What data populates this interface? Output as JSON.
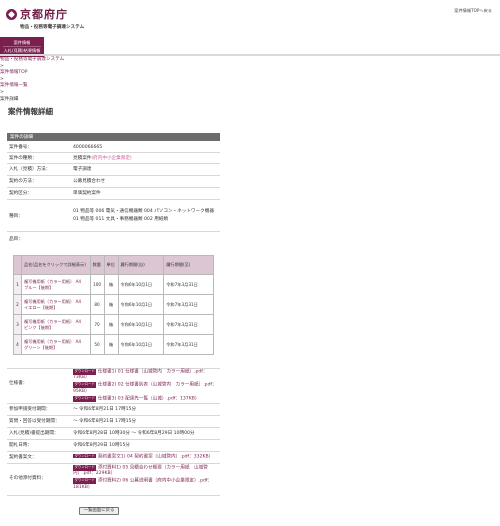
{
  "header": {
    "logo_text": "京都府庁",
    "logo_sub": "物品・役務等電子調達システム",
    "top_link": "案件情報TOPへ戻る"
  },
  "nav": {
    "item1": "案件情報",
    "item2": "入札(見積)結果情報"
  },
  "breadcrumb": {
    "root": "物品・役務等電子調達システム",
    "sep1": ">",
    "top": "案件情報TOP",
    "sep2": ">",
    "list": "案件情報一覧",
    "sep3": ">",
    "current": "案件詳細"
  },
  "page_title": "案件情報詳細",
  "section_title": "案件の詳細",
  "details": {
    "case_no_label": "案件番号：",
    "case_no": "4000066665",
    "kind_label": "案件の種類：",
    "kind": "見積案件",
    "kind_note": "(府内中小企業限定)",
    "method_label": "入札（見積）方法：",
    "method": "電子調達",
    "contract_label": "契約の方法：",
    "contract": "公募見積合わせ",
    "category_label": "契約区分：",
    "category": "単価契約案件",
    "types_label": "種目：",
    "types_line1": "01 物品等 006 電気・通信機器類 004 パソコン・ネットワーク機器",
    "types_line2": "01 物品等 011 文具・事務機器類 002 用紙類",
    "items_label": "品目："
  },
  "items_table": {
    "headers": [
      "品名(品名をクリックで詳細表示)",
      "数量",
      "単位",
      "履行期間(自)",
      "履行期間(至)"
    ],
    "rows": [
      {
        "no": "1",
        "name": "複写機用紙（カラー用紙） A4　ブルー【後期】",
        "qty": "100",
        "unit": "箱",
        "from": "令和6年10月1日",
        "to": "令和7年3月31日"
      },
      {
        "no": "2",
        "name": "複写機用紙（カラー用紙） A4　イエロー【後期】",
        "qty": "80",
        "unit": "箱",
        "from": "令和6年10月1日",
        "to": "令和7年3月31日"
      },
      {
        "no": "3",
        "name": "複写機用紙（カラー用紙） A4　ピンク【後期】",
        "qty": "70",
        "unit": "箱",
        "from": "令和6年10月1日",
        "to": "令和7年3月31日"
      },
      {
        "no": "4",
        "name": "複写機用紙（カラー用紙） A4　グリーン【後期】",
        "qty": "50",
        "unit": "箱",
        "from": "令和6年10月1日",
        "to": "令和7年3月31日"
      }
    ]
  },
  "spec": {
    "label": "仕様書：",
    "badge": "ダウンロード",
    "file1a": "仕様書1) 01 仕様書（山城管内　カラー用紙）.pdf：",
    "file1b": "73KB）",
    "file2a": "仕様書2) 02 仕様書別表（山城管内　カラー用紙）.pdf：",
    "file2b": "95KB）",
    "file3": "仕様書3) 03 配達先一覧（山城）.pdf：137KB）"
  },
  "schedule": {
    "apply_label": "参加申請受付期間：",
    "apply": "〜 令和6年8月21日 17時15分",
    "question_label": "質問・回答以受付期間：",
    "question": "〜 令和6年8月21日 17時15分",
    "submit_label": "入札(見積)書提出期間：",
    "submit": "令和6年8月28日 10時30分 〜 令和6年8月29日 10時00分",
    "open_label": "開札日時：",
    "open": "令和6年8月29日 10時15分"
  },
  "contract_doc": {
    "label": "契約書案文：",
    "file": "契約書案文1) 04 契約書案（山城管内）.pdf：332KB）"
  },
  "other_docs": {
    "label": "その他添付資料：",
    "file1a": "添付資料1) 05 見積合わせ概要（カラー用紙　山城管",
    "file1b": "内）.pdf：229KB）",
    "file2a": "添付資料2) 06 公募説明書（府内中小企業限定）.pdf：",
    "file2b": "181KB）"
  },
  "back_button": "一覧画面に戻る",
  "colors": {
    "brand": "#7b1f4f",
    "section": "#6c6c6c",
    "table_header": "#dcc6d4"
  }
}
